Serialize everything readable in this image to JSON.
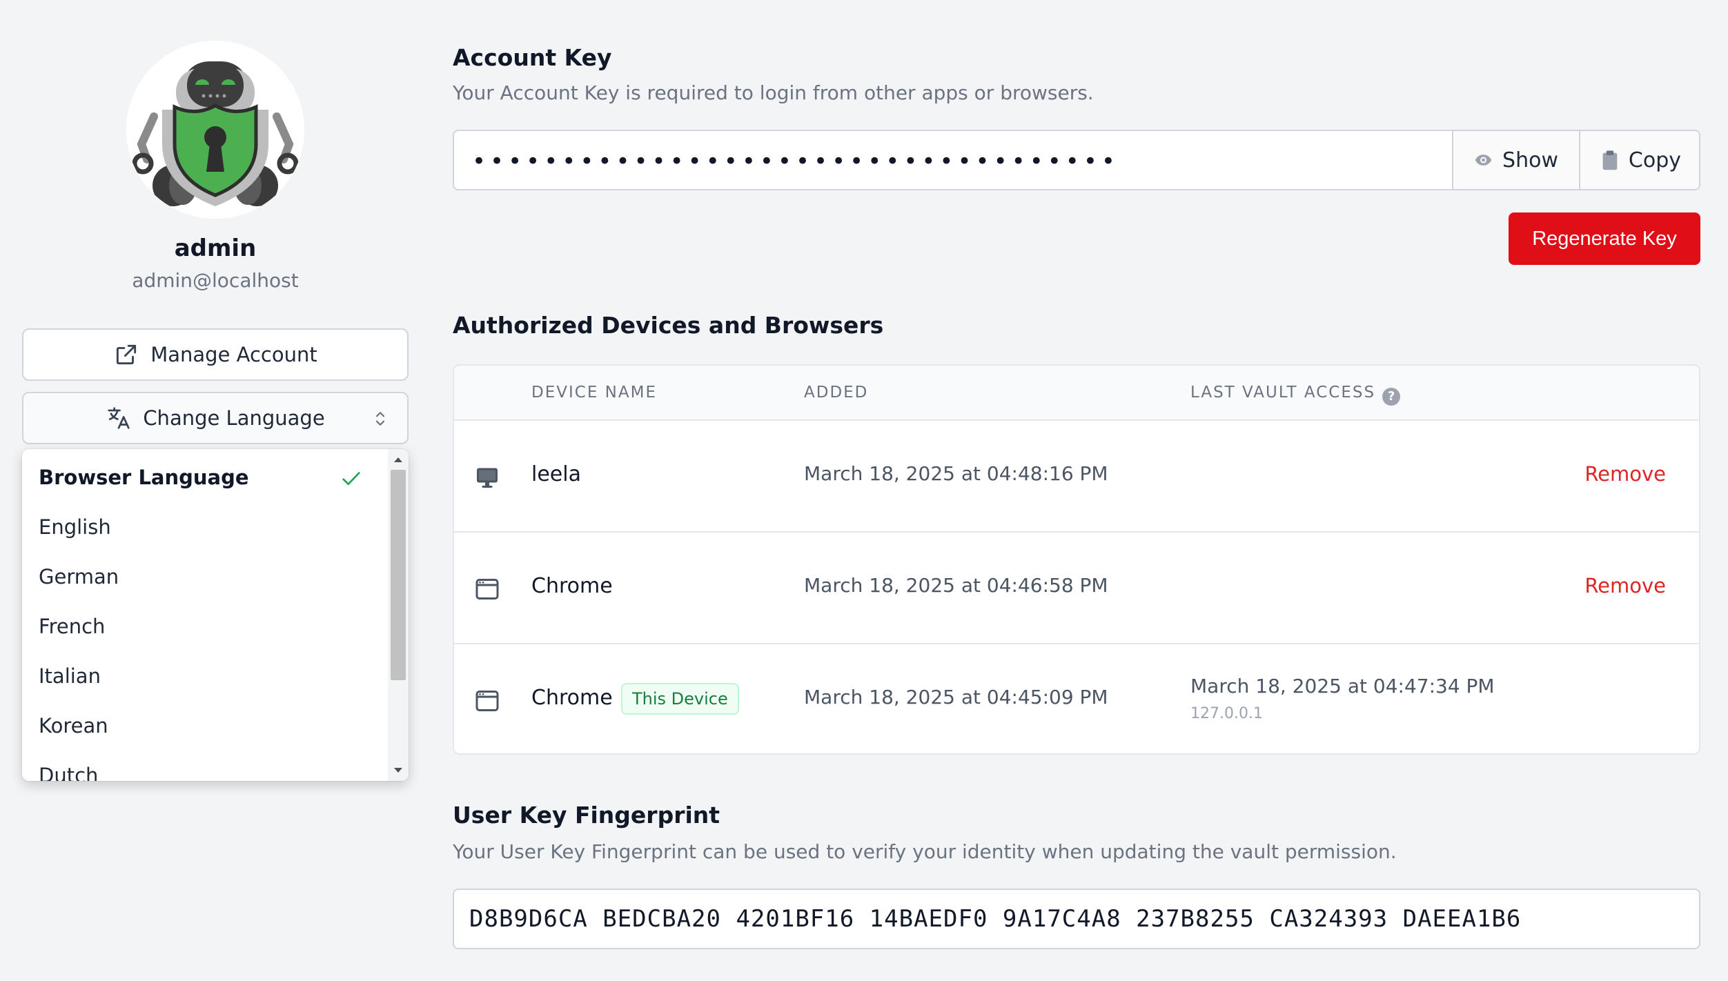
{
  "user": {
    "name": "admin",
    "email": "admin@localhost"
  },
  "sidebar": {
    "manage_account_label": "Manage Account",
    "change_language_label": "Change Language",
    "languages": [
      "Browser Language",
      "English",
      "German",
      "French",
      "Italian",
      "Korean",
      "Dutch"
    ],
    "selected_language": "Browser Language"
  },
  "account_key": {
    "title": "Account Key",
    "description": "Your Account Key is required to login from other apps or browsers.",
    "masked_value": "••••••••••••••••••••••••••••••••••••",
    "show_label": "Show",
    "copy_label": "Copy",
    "regenerate_label": "Regenerate Key"
  },
  "devices": {
    "title": "Authorized Devices and Browsers",
    "columns": [
      "DEVICE NAME",
      "ADDED",
      "LAST VAULT ACCESS"
    ],
    "help_glyph": "?",
    "rows": [
      {
        "icon": "desktop-icon",
        "name": "leela",
        "added": "March 18, 2025 at 04:48:16 PM",
        "last_access": "",
        "ip": "",
        "badge": "",
        "action": "Remove"
      },
      {
        "icon": "browser-window-icon",
        "name": "Chrome",
        "added": "March 18, 2025 at 04:46:58 PM",
        "last_access": "",
        "ip": "",
        "badge": "",
        "action": "Remove"
      },
      {
        "icon": "browser-window-icon",
        "name": "Chrome",
        "added": "March 18, 2025 at 04:45:09 PM",
        "last_access": "March 18, 2025 at 04:47:34 PM",
        "ip": "127.0.0.1",
        "badge": "This Device",
        "action": ""
      }
    ]
  },
  "fingerprint": {
    "title": "User Key Fingerprint",
    "description": "Your User Key Fingerprint can be used to verify your identity when updating the vault permission.",
    "value": "D8B9D6CA BEDCBA20 4201BF16 14BAEDF0 9A17C4A8 237B8255 CA324393 DAEEA1B6"
  },
  "colors": {
    "danger": "#e00e17",
    "shield_green": "#4caf50",
    "badge_green": "#15803d"
  }
}
